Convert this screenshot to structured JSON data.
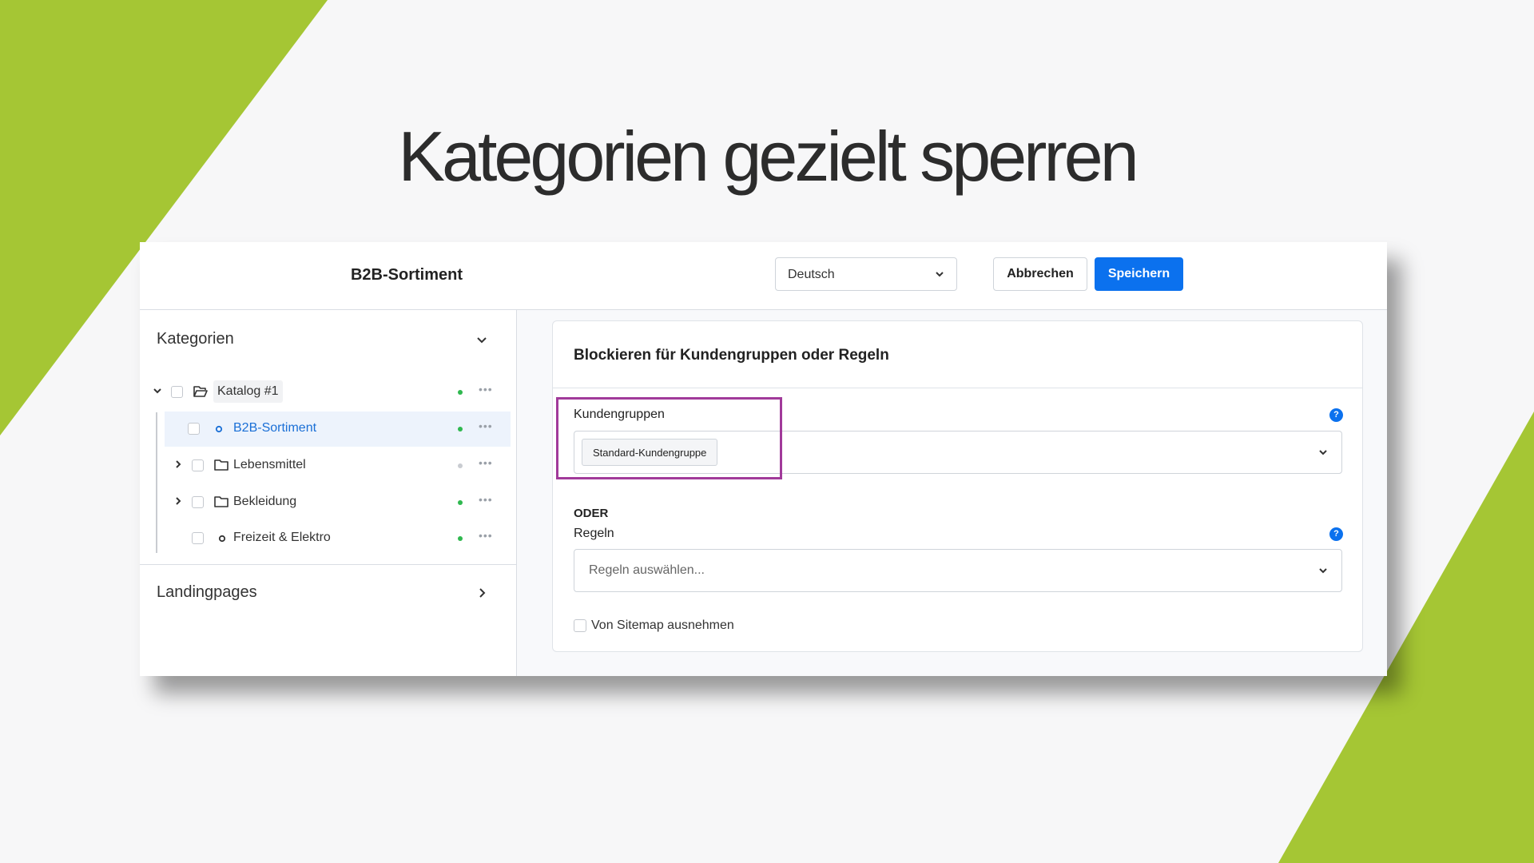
{
  "headline": "Kategorien gezielt sperren",
  "colors": {
    "accent_green": "#a5c634",
    "primary_blue": "#0b71ee",
    "highlight": "#a13a9a",
    "status_green": "#2fb84f",
    "status_grey": "#c9ccd1"
  },
  "topbar": {
    "title": "B2B-Sortiment",
    "language": "Deutsch",
    "cancel_label": "Abbrechen",
    "save_label": "Speichern"
  },
  "sidebar": {
    "categories_title": "Kategorien",
    "tree": [
      {
        "label": "Katalog #1",
        "icon": "folder-open-icon",
        "status": "active"
      },
      {
        "label": "B2B-Sortiment",
        "icon": "circle-icon",
        "status": "active",
        "selected": true
      },
      {
        "label": "Lebensmittel",
        "icon": "folder-icon",
        "status": "inactive"
      },
      {
        "label": "Bekleidung",
        "icon": "folder-icon",
        "status": "active"
      },
      {
        "label": "Freizeit & Elektro",
        "icon": "circle-icon",
        "status": "active"
      }
    ],
    "landingpages_title": "Landingpages"
  },
  "card": {
    "title": "Blockieren für Kundengruppen oder Regeln",
    "customer_groups_label": "Kundengruppen",
    "customer_group_tag": "Standard-Kundengruppe",
    "oder": "ODER",
    "rules_label": "Regeln",
    "rules_placeholder": "Regeln auswählen...",
    "sitemap_label": "Von Sitemap ausnehmen",
    "help_glyph": "?"
  }
}
